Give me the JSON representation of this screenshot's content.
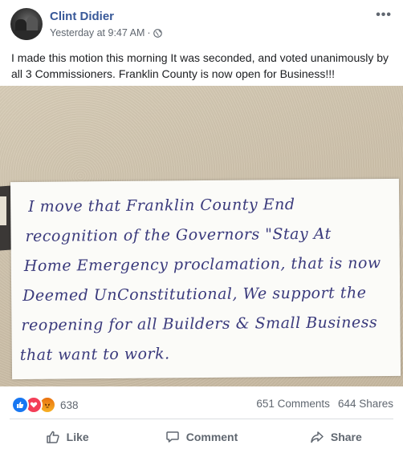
{
  "post": {
    "author": "Clint Didier",
    "timestamp": "Yesterday at 9:47 AM",
    "separator": "·",
    "privacy_icon": "globe-icon",
    "more_icon": "ellipsis",
    "more_label": "•••",
    "text": "I made this motion this morning It was seconded, and voted unanimously by all 3 Commissioners. Franklin County is now open for Business!!!"
  },
  "photo": {
    "note_lines": [
      "I move that Franklin County End",
      "recognition of the Governors \"Stay At",
      "Home Emergency proclamation, that is now",
      "Deemed UnConstitutional, We support the",
      "reopening for all Builders & Small Business",
      "that want to work."
    ]
  },
  "reactions": {
    "types": [
      "like",
      "love",
      "angry"
    ],
    "count": "638"
  },
  "stats": {
    "comments": "651 Comments",
    "shares": "644 Shares"
  },
  "actions": {
    "like": "Like",
    "comment": "Comment",
    "share": "Share"
  },
  "colors": {
    "author": "#385898",
    "meta": "#606770",
    "like_blue": "#1877f2",
    "love_red": "#f33e58",
    "ink": "#3a3a7c"
  }
}
